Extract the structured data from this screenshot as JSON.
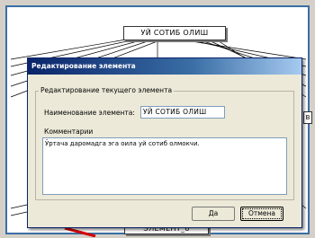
{
  "diagram": {
    "top_node_label": "УЙ СОТИБ ОЛИШ",
    "bottom_node_label": "ЭЛЕМЕНТ_6",
    "right_node_label": "В"
  },
  "dialog": {
    "title": "Редактирование элемента",
    "group_title": "Редактирование текущего элемента",
    "name_label": "Наименование элемента:",
    "name_value": "УЙ СОТИБ ОЛИШ",
    "comments_label": "Комментарии",
    "comments_value": "Ўртача даромадга эга оила уй сотиб олмокчи.",
    "ok_button": "Да",
    "cancel_button": "Отмена"
  },
  "colors": {
    "frame_blue": "#3a6ea5",
    "titlebar_dark": "#0a246a",
    "arrow_red": "#d40000"
  }
}
